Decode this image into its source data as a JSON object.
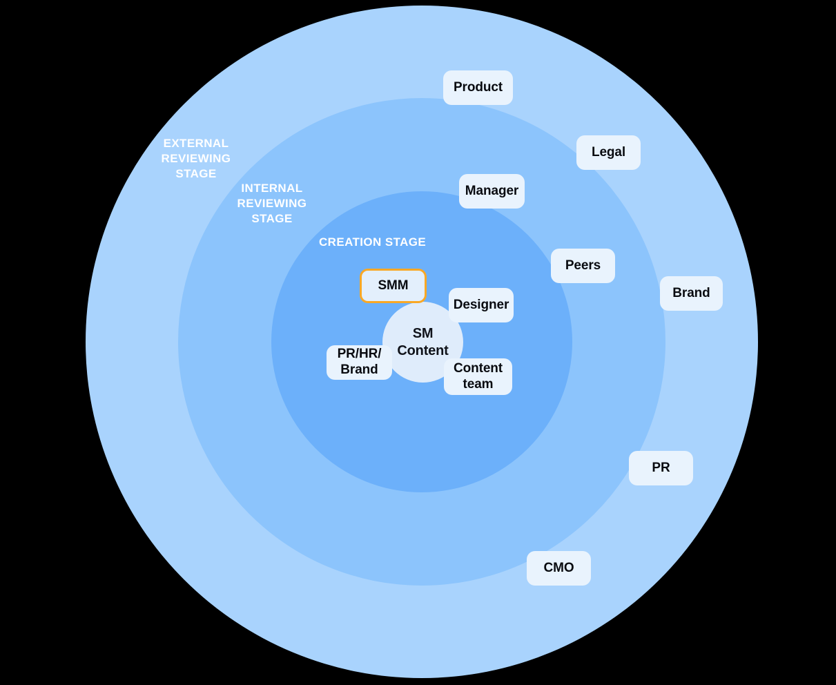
{
  "diagram": {
    "type": "concentric-stage-venn",
    "background_color": "#000000",
    "core": {
      "label": "SM\nContent",
      "fill": "#dfecfb"
    },
    "rings": [
      {
        "id": "external",
        "caption": "EXTERNAL\nREVIEWING\nSTAGE",
        "fill": "#a9d3fd"
      },
      {
        "id": "internal",
        "caption": "INTERNAL\nREVIEWING\nSTAGE",
        "fill": "#8cc4fc"
      },
      {
        "id": "creation",
        "caption": "CREATION STAGE",
        "fill": "#6cb0fa"
      }
    ],
    "chips": [
      {
        "id": "product",
        "label": "Product",
        "stage": "external",
        "highlighted": false
      },
      {
        "id": "legal",
        "label": "Legal",
        "stage": "external",
        "highlighted": false
      },
      {
        "id": "manager",
        "label": "Manager",
        "stage": "internal",
        "highlighted": false
      },
      {
        "id": "peers",
        "label": "Peers",
        "stage": "internal",
        "highlighted": false
      },
      {
        "id": "brand",
        "label": "Brand",
        "stage": "external",
        "highlighted": false
      },
      {
        "id": "smm",
        "label": "SMM",
        "stage": "creation",
        "highlighted": true
      },
      {
        "id": "designer",
        "label": "Designer",
        "stage": "creation",
        "highlighted": false
      },
      {
        "id": "prhrbrand",
        "label": "PR/HR/\nBrand",
        "stage": "creation",
        "highlighted": false
      },
      {
        "id": "contentteam",
        "label": "Content\nteam",
        "stage": "creation",
        "highlighted": false
      },
      {
        "id": "pr",
        "label": "PR",
        "stage": "external",
        "highlighted": false
      },
      {
        "id": "cmo",
        "label": "CMO",
        "stage": "external",
        "highlighted": false
      }
    ],
    "colors": {
      "chip_fill": "#e9f3fd",
      "chip_text": "#090b10",
      "highlight_border": "#f9a825",
      "caption_text": "#ffffff"
    }
  }
}
